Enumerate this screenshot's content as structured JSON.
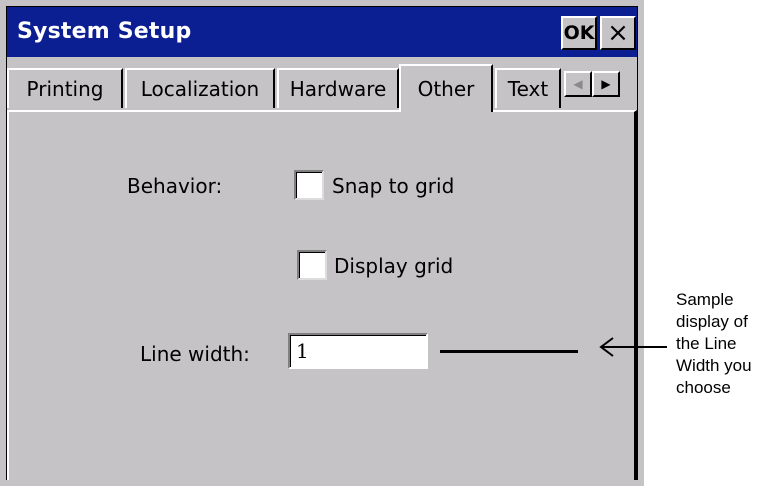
{
  "window": {
    "title": "System Setup",
    "ok_label": "OK",
    "close_glyph": "×"
  },
  "tabs": [
    {
      "label": "Printing"
    },
    {
      "label": "Localization"
    },
    {
      "label": "Hardware"
    },
    {
      "label": "Other",
      "active": true
    },
    {
      "label": "Text"
    }
  ],
  "tab_scroll": {
    "left_glyph": "◀",
    "right_glyph": "▶"
  },
  "settings": {
    "behavior_label": "Behavior:",
    "snap_to_grid": {
      "label": "Snap to grid",
      "checked": false
    },
    "display_grid": {
      "label": "Display grid",
      "checked": false
    },
    "line_width_label": "Line width:",
    "line_width_value": "1"
  },
  "annotation": {
    "text": "Sample display of the Line Width you choose"
  },
  "colors": {
    "titlebar": "#0c1f92",
    "face": "#c6c3c6"
  }
}
